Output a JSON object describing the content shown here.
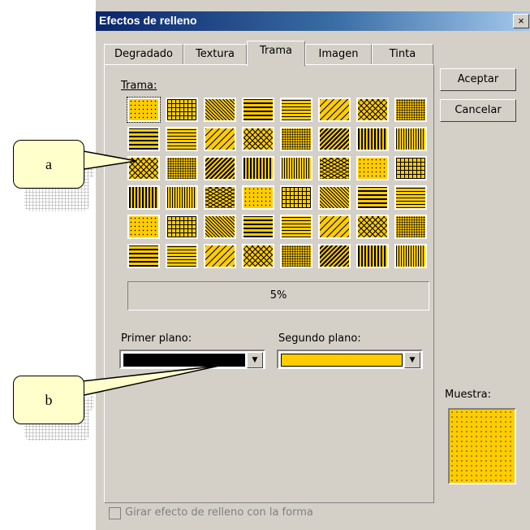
{
  "window": {
    "title": "Efectos de relleno",
    "close_glyph": "×"
  },
  "tabs": [
    {
      "label": "Degradado",
      "active": false
    },
    {
      "label": "Textura",
      "active": false
    },
    {
      "label": "Trama",
      "active": true
    },
    {
      "label": "Imagen",
      "active": false
    },
    {
      "label": "Tinta",
      "active": false
    }
  ],
  "trama": {
    "label": "Trama:",
    "selected_index": 0,
    "selected_name": "5%",
    "rows": 6,
    "cols": 8,
    "colors": {
      "foreground": "#000000",
      "background": "#ffcc00"
    }
  },
  "primer_plano": {
    "label": "Primer plano:",
    "color": "#000000"
  },
  "segundo_plano": {
    "label": "Segundo plano:",
    "color": "#ffcc00"
  },
  "buttons": {
    "accept": "Aceptar",
    "cancel": "Cancelar"
  },
  "muestra": {
    "label": "Muestra:"
  },
  "rotate_checkbox": {
    "label": "Girar efecto de relleno con la forma",
    "checked": false,
    "enabled": false
  },
  "callouts": [
    {
      "letter": "a"
    },
    {
      "letter": "b"
    }
  ]
}
